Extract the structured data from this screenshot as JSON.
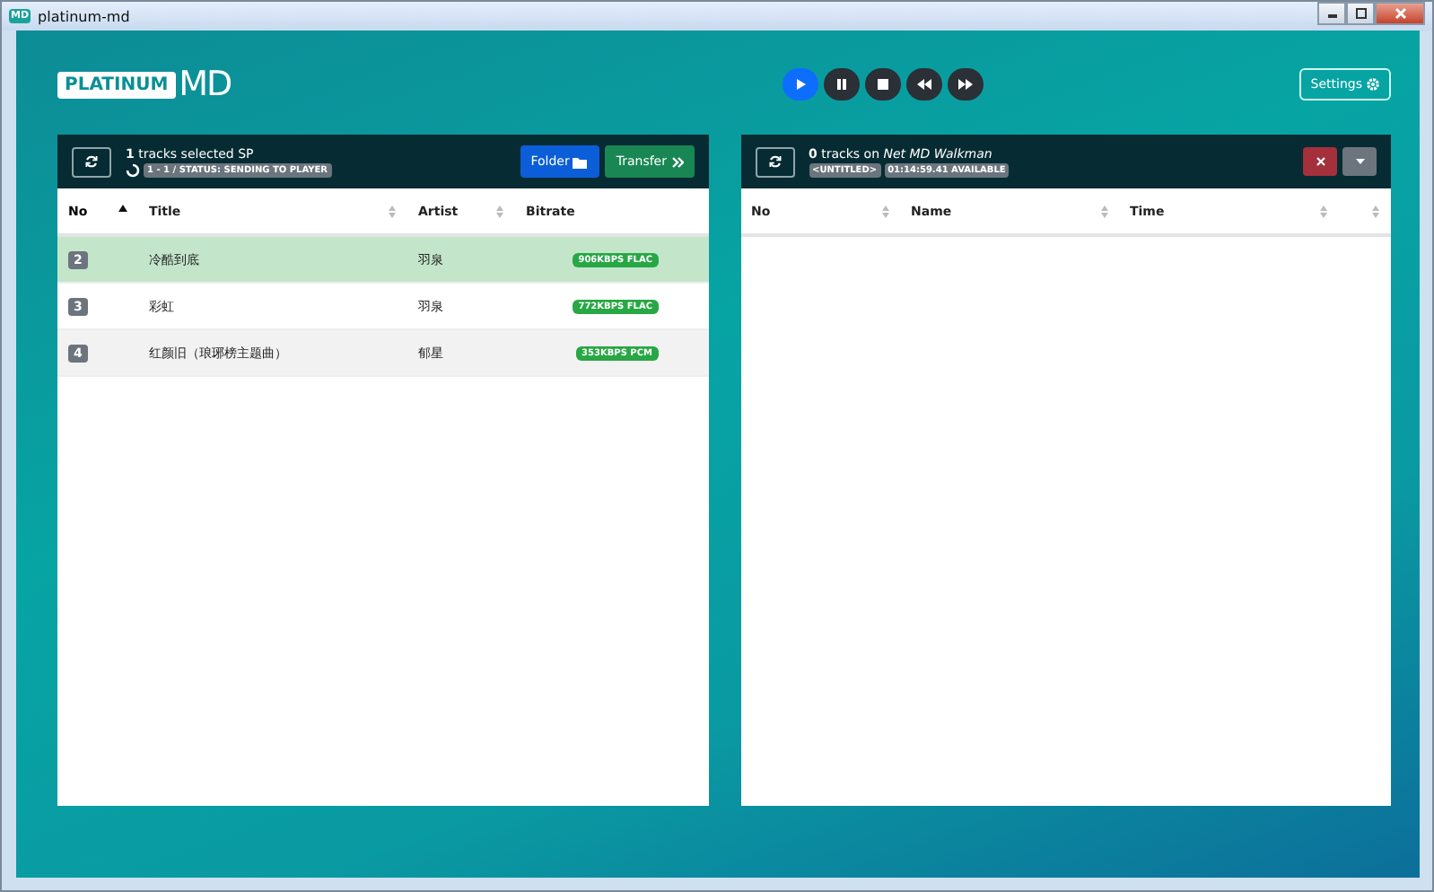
{
  "window": {
    "title": "platinum-md",
    "app_icon": "MD"
  },
  "logo": {
    "badge": "PLATINUM",
    "mark": "MD"
  },
  "player": [
    {
      "kind": "play",
      "selected": true
    },
    {
      "kind": "pause",
      "selected": false
    },
    {
      "kind": "stop",
      "selected": false
    },
    {
      "kind": "prev",
      "selected": false
    },
    {
      "kind": "next",
      "selected": false
    }
  ],
  "settings": {
    "label": "Settings"
  },
  "left_panel": {
    "count": "1",
    "summary": "tracks selected SP",
    "status": "1 - 1 / STATUS: SENDING TO PLAYER",
    "buttons": [
      {
        "kind": "folder",
        "label": "Folder"
      },
      {
        "kind": "transfer",
        "label": "Transfer"
      }
    ],
    "columns": [
      {
        "label": "No",
        "sortable": true,
        "sorted": true
      },
      {
        "label": "Title",
        "sortable": true,
        "sorted": false
      },
      {
        "label": "Artist",
        "sortable": true,
        "sorted": false
      },
      {
        "label": "Bitrate",
        "sortable": false,
        "sorted": false
      }
    ],
    "rows": [
      {
        "no": "2",
        "title": "冷酷到底",
        "artist": "羽泉",
        "bitrate": "906KBPS FLAC",
        "selected": true
      },
      {
        "no": "3",
        "title": "彩虹",
        "artist": "羽泉",
        "bitrate": "772KBPS FLAC",
        "selected": false
      },
      {
        "no": "4",
        "title": "红颜旧（琅琊榜主题曲）",
        "artist": "郁星",
        "bitrate": "353KBPS PCM",
        "selected": false
      }
    ]
  },
  "right_panel": {
    "count": "0",
    "summary": "tracks on",
    "device": "Net MD Walkman",
    "badges": [
      "<UNTITLED>",
      "01:14:59.41 AVAILABLE"
    ],
    "columns": [
      {
        "label": "No",
        "sortable": true,
        "sorted": false
      },
      {
        "label": "Name",
        "sortable": true,
        "sorted": false
      },
      {
        "label": "Time",
        "sortable": true,
        "sorted": false
      },
      {
        "sortable": true,
        "sorted": false
      }
    ]
  }
}
